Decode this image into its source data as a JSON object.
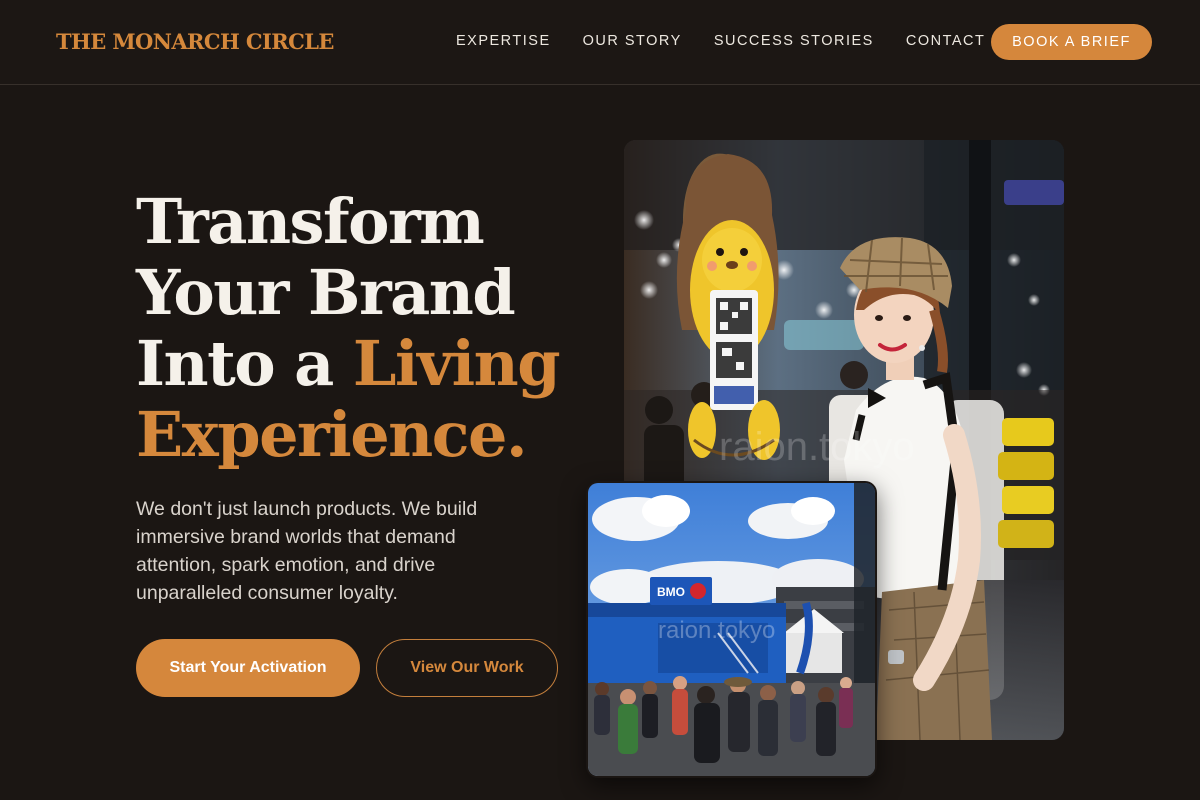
{
  "header": {
    "brand": "THE MONARCH CIRCLE",
    "nav": [
      "EXPERTISE",
      "OUR STORY",
      "SUCCESS STORIES",
      "CONTACT"
    ],
    "cta": "BOOK A BRIEF"
  },
  "hero": {
    "headline_line1": "Transform",
    "headline_line2": "Your Brand",
    "headline_line3a": "Into a ",
    "headline_line3b": "Living",
    "headline_line4": "Experience.",
    "subcopy": "We don't just launch products. We build immersive brand worlds that demand attention, spark emotion, and drive unparalleled consumer loyalty.",
    "primary_button": "Start Your Activation",
    "secondary_button": "View Our Work"
  },
  "images": {
    "main": {
      "description": "Woman in plaid cap holding a lion mascot QR sign at an expo",
      "watermark": "raion.tokyo"
    },
    "secondary": {
      "description": "Outdoor event crowd in front of a blue BMO trailer",
      "watermark": "raion.tokyo",
      "sign_text": "BMO"
    }
  },
  "colors": {
    "background": "#1b1613",
    "accent": "#d5883c",
    "text": "#f5f1ea"
  }
}
